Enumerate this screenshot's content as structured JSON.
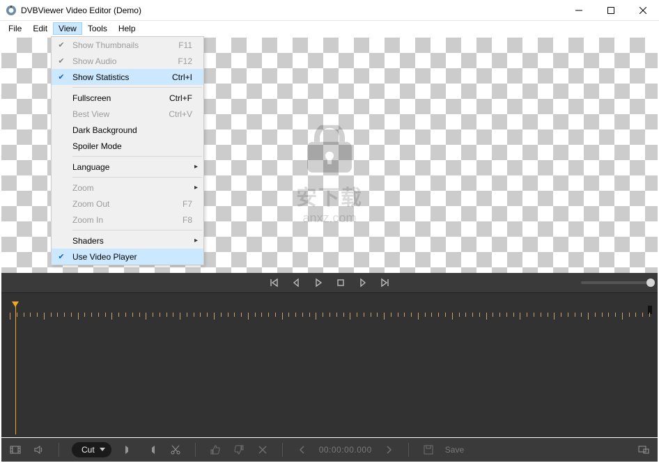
{
  "window": {
    "title": "DVBViewer Video Editor (Demo)"
  },
  "menubar": [
    "File",
    "Edit",
    "View",
    "Tools",
    "Help"
  ],
  "view_menu": [
    {
      "label": "Show Thumbnails",
      "shortcut": "F11",
      "checked": true,
      "disabled": true
    },
    {
      "label": "Show Audio",
      "shortcut": "F12",
      "checked": true,
      "disabled": true
    },
    {
      "label": "Show Statistics",
      "shortcut": "Ctrl+I",
      "checked": true,
      "highlight": true
    },
    {
      "sep": true
    },
    {
      "label": "Fullscreen",
      "shortcut": "Ctrl+F"
    },
    {
      "label": "Best View",
      "shortcut": "Ctrl+V",
      "disabled": true
    },
    {
      "label": "Dark Background"
    },
    {
      "label": "Spoiler Mode"
    },
    {
      "sep": true
    },
    {
      "label": "Language",
      "submenu": true
    },
    {
      "sep": true
    },
    {
      "label": "Zoom",
      "submenu": true,
      "disabled": true
    },
    {
      "label": "Zoom Out",
      "shortcut": "F7",
      "disabled": true
    },
    {
      "label": "Zoom In",
      "shortcut": "F8",
      "disabled": true
    },
    {
      "sep": true
    },
    {
      "label": "Shaders",
      "submenu": true
    },
    {
      "label": "Use Video Player",
      "checked": true,
      "highlight": true
    }
  ],
  "watermark": {
    "zh": "安下载",
    "en": "anxz.com"
  },
  "bottombar": {
    "cut_label": "Cut",
    "timecode": "00:00:00.000",
    "save_label": "Save"
  }
}
